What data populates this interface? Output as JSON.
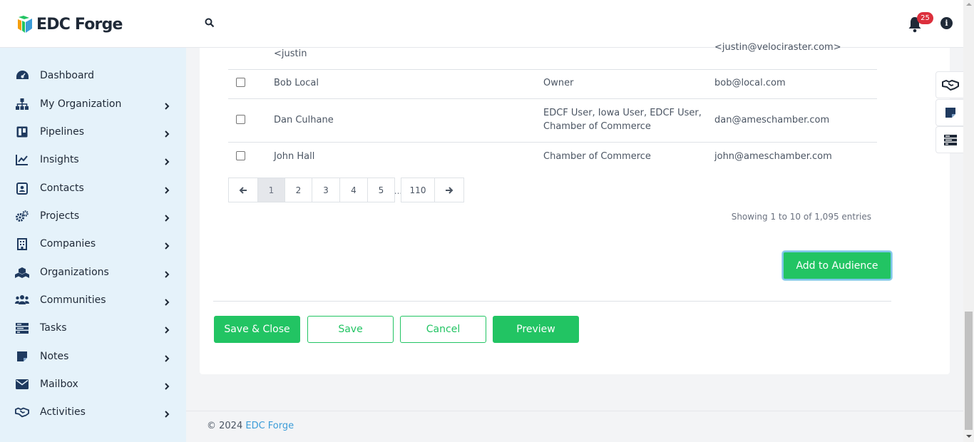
{
  "app": {
    "brand_name": "EDC Forge",
    "notification_count": "25",
    "info_glyph": "i",
    "brand_colors": {
      "green": "#22c463",
      "blue": "#3b9cd8",
      "badge_red": "#dc2f3c"
    }
  },
  "sidebar": {
    "items": [
      {
        "label": "Dashboard",
        "icon": "dashboard-icon",
        "has_children": false
      },
      {
        "label": "My Organization",
        "icon": "sitemap-icon",
        "has_children": true
      },
      {
        "label": "Pipelines",
        "icon": "pipelines-icon",
        "has_children": true
      },
      {
        "label": "Insights",
        "icon": "chart-line-icon",
        "has_children": true
      },
      {
        "label": "Contacts",
        "icon": "contact-card-icon",
        "has_children": true
      },
      {
        "label": "Projects",
        "icon": "cogs-icon",
        "has_children": true
      },
      {
        "label": "Companies",
        "icon": "building-icon",
        "has_children": true
      },
      {
        "label": "Organizations",
        "icon": "cubes-icon",
        "has_children": true
      },
      {
        "label": "Communities",
        "icon": "users-icon",
        "has_children": true
      },
      {
        "label": "Tasks",
        "icon": "tasks-icon",
        "has_children": true
      },
      {
        "label": "Notes",
        "icon": "note-icon",
        "has_children": true
      },
      {
        "label": "Mailbox",
        "icon": "envelope-icon",
        "has_children": true
      },
      {
        "label": "Activities",
        "icon": "handshake-icon",
        "has_children": true
      }
    ]
  },
  "table": {
    "partial_row": {
      "name": "<justin",
      "email": "<justin@velociraster.com>"
    },
    "rows": [
      {
        "name": "Bob Local",
        "roles": "Owner",
        "roles_line2": "",
        "email": "bob@local.com"
      },
      {
        "name": "Dan Culhane",
        "roles": "EDCF User, Iowa User, EDCF User,",
        "roles_line2": "Chamber of Commerce",
        "email": "dan@ameschamber.com"
      },
      {
        "name": "John Hall",
        "roles": "Chamber of Commerce",
        "roles_line2": "",
        "email": "john@ameschamber.com"
      }
    ]
  },
  "pagination": {
    "pages": [
      "1",
      "2",
      "3",
      "4",
      "5"
    ],
    "ellipsis": "...",
    "last_page": "110",
    "current": "1",
    "showing_text": "Showing 1 to 10 of 1,095 entries"
  },
  "actions": {
    "add_to_audience": "Add to Audience",
    "save_close": "Save & Close",
    "save": "Save",
    "cancel": "Cancel",
    "preview": "Preview"
  },
  "footer": {
    "copyright": "© 2024 ",
    "link_text": "EDC Forge"
  }
}
